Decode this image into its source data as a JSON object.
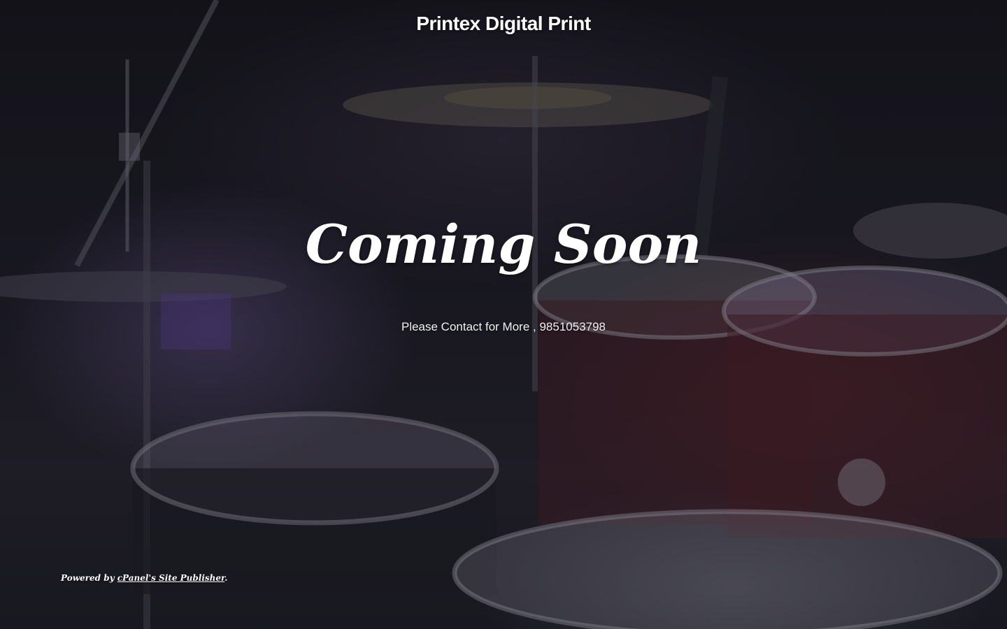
{
  "site": {
    "title": "Printex Digital Print"
  },
  "main": {
    "headline": "Coming Soon",
    "contact_text": "Please Contact for More , 9851053798"
  },
  "footer": {
    "prefix": "Powered by ",
    "link_label": "cPanel's Site Publisher",
    "suffix": "."
  },
  "background": {
    "image_subject": "drum-kit-photo",
    "overlay_color": "#14141c"
  }
}
